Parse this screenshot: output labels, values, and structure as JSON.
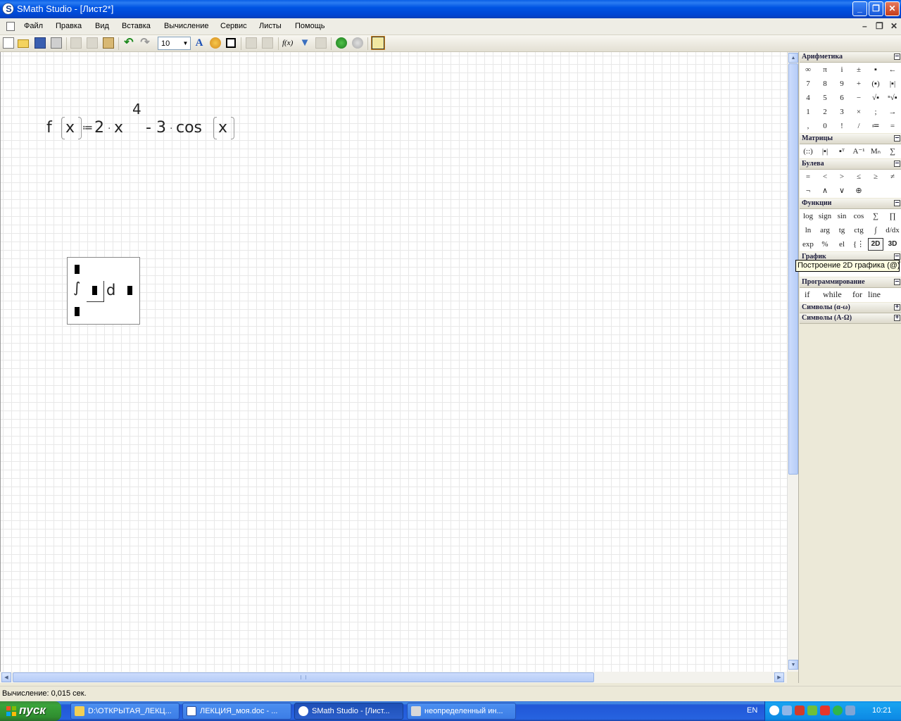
{
  "window": {
    "title": "SMath Studio - [Лист2*]",
    "app_icon_letter": "S",
    "controls": {
      "minimize": "_",
      "maximize": "❐",
      "close": "✕"
    }
  },
  "menu": {
    "items": [
      "Файл",
      "Правка",
      "Вид",
      "Вставка",
      "Вычисление",
      "Сервис",
      "Листы",
      "Помощь"
    ],
    "mdi_controls": {
      "minimize": "–",
      "restore": "❐",
      "close": "✕"
    }
  },
  "toolbar": {
    "font_size": "10",
    "font_size_arrow": "▼",
    "text_icon": "A",
    "function_label": "f(x)",
    "undo_glyph": "↶",
    "redo_glyph": "↷",
    "filter_glyph": "▼"
  },
  "worksheet": {
    "formula": {
      "f": "f",
      "x1": "x",
      "assign": "≔",
      "two": "2",
      "x2": "x",
      "exponent": "4",
      "minus": "-",
      "three": "3",
      "cos": "cos",
      "x3": "x",
      "dot": "·"
    },
    "integral": {
      "sign": "∫",
      "d": "d"
    }
  },
  "scrollbar": {
    "up": "▲",
    "down": "▼",
    "left": "◀",
    "right": "▶"
  },
  "panel": {
    "arithmetic": {
      "title": "Арифметика",
      "toggle": "–",
      "rows": [
        [
          "∞",
          "π",
          "i",
          "±",
          "▪",
          "←"
        ],
        [
          "7",
          "8",
          "9",
          "+",
          "(▪)",
          "|▪|"
        ],
        [
          "4",
          "5",
          "6",
          "−",
          "√▪",
          "ⁿ√▪"
        ],
        [
          "1",
          "2",
          "3",
          "×",
          ";",
          "→"
        ],
        [
          ",",
          "0",
          "!",
          "/",
          "≔",
          "="
        ]
      ]
    },
    "matrices": {
      "title": "Матрицы",
      "toggle": "–",
      "items": [
        "(::)",
        "|▪|",
        "▪ᵀ",
        "A⁻¹",
        "Mₙ",
        "∑"
      ]
    },
    "boolean": {
      "title": "Булева",
      "toggle": "–",
      "rows": [
        [
          "=",
          "<",
          ">",
          "≤",
          "≥",
          "≠"
        ],
        [
          "¬",
          "∧",
          "∨",
          "⊕"
        ]
      ]
    },
    "functions": {
      "title": "Функции",
      "toggle": "–",
      "rows": [
        [
          "log",
          "sign",
          "sin",
          "cos",
          "∑",
          "∏"
        ],
        [
          "ln",
          "arg",
          "tg",
          "ctg",
          "∫",
          "d/dx"
        ],
        [
          "exp",
          "%",
          "el",
          "{⋮",
          "2D",
          "3D"
        ]
      ]
    },
    "graph": {
      "title": "График",
      "toggle": "–"
    },
    "programming": {
      "title": "Программирование",
      "toggle": "–",
      "items": [
        "if",
        "while",
        "for",
        "line"
      ]
    },
    "symbols_lower": {
      "title": "Символы (α-ω)",
      "toggle": "+"
    },
    "symbols_upper": {
      "title": "Символы (Α-Ω)",
      "toggle": "+"
    }
  },
  "tooltip": "Построение 2D графика (@)",
  "status": "Вычисление: 0,015 сек.",
  "taskbar": {
    "start": "пуск",
    "tasks": [
      {
        "label": "D:\\ОТКРЫТАЯ_ЛЕКЦ...",
        "active": false
      },
      {
        "label": "ЛЕКЦИЯ_моя.doc - ...",
        "active": false
      },
      {
        "label": "SMath Studio - [Лист...",
        "active": true
      },
      {
        "label": "неопределенный ин...",
        "active": false
      }
    ],
    "language": "EN",
    "clock": "10:21"
  }
}
